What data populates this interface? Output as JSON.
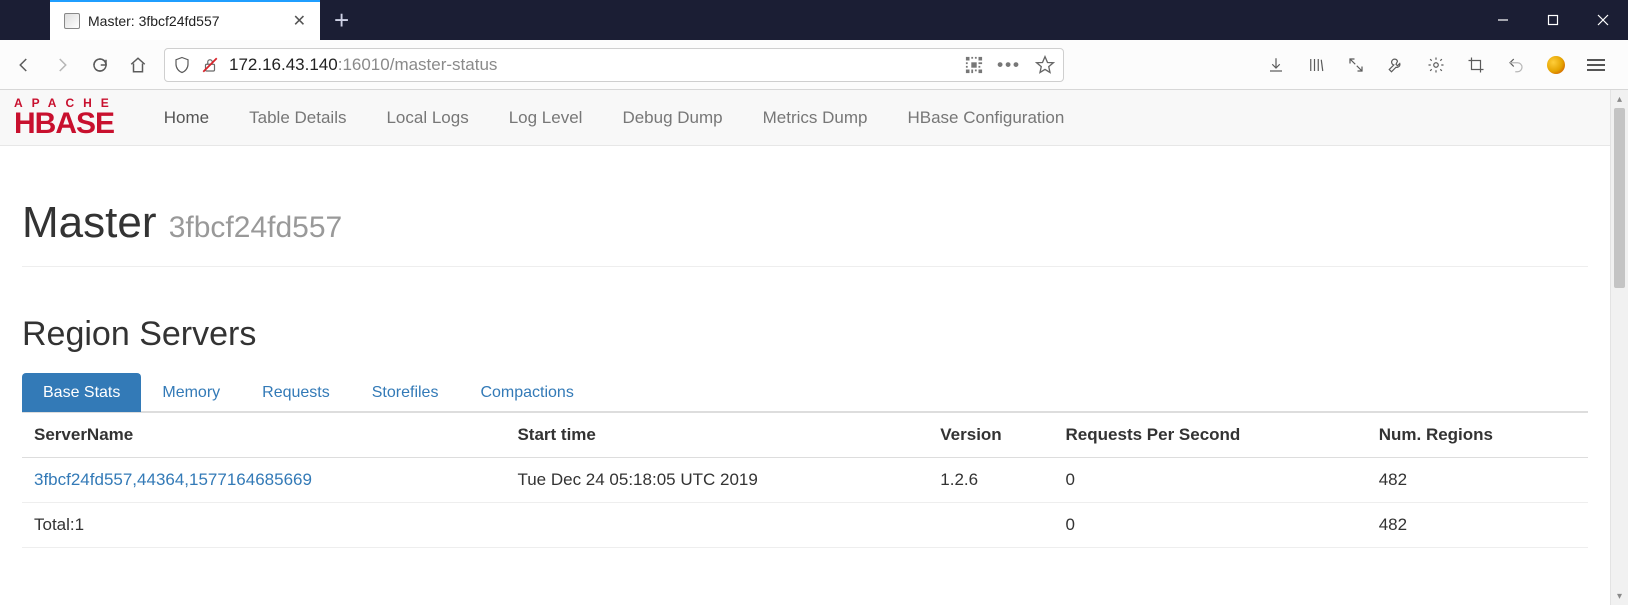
{
  "browser": {
    "tab_title": "Master: 3fbcf24fd557",
    "url_host": "172.16.43.140",
    "url_path": ":16010/master-status"
  },
  "nav": {
    "logo_top": "APACHE",
    "logo_bottom": "HBASE",
    "links": [
      "Home",
      "Table Details",
      "Local Logs",
      "Log Level",
      "Debug Dump",
      "Metrics Dump",
      "HBase Configuration"
    ]
  },
  "header": {
    "title": "Master",
    "subtitle": "3fbcf24fd557"
  },
  "section_title": "Region Servers",
  "tabs": [
    "Base Stats",
    "Memory",
    "Requests",
    "Storefiles",
    "Compactions"
  ],
  "table": {
    "columns": [
      "ServerName",
      "Start time",
      "Version",
      "Requests Per Second",
      "Num. Regions"
    ],
    "rows": [
      {
        "server_link": "3fbcf24fd557,44364,1577164685669",
        "start_time": "Tue Dec 24 05:18:05 UTC 2019",
        "version": "1.2.6",
        "rps": "0",
        "regions": "482"
      }
    ],
    "total": {
      "label": "Total:1",
      "rps": "0",
      "regions": "482"
    }
  }
}
